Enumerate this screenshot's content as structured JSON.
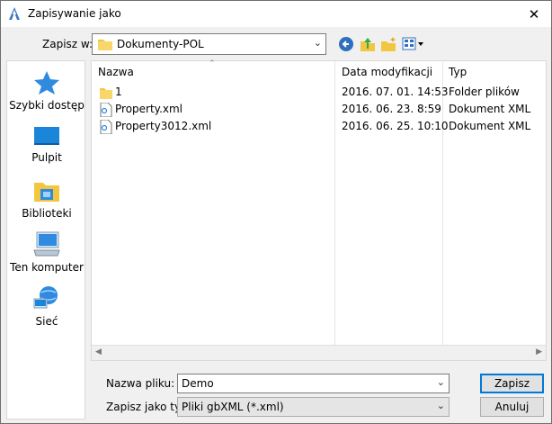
{
  "window": {
    "title": "Zapisywanie jako",
    "close_glyph": "✕"
  },
  "toolbar": {
    "save_in_label": "Zapisz w:",
    "save_in_value": "Dokumenty-POL",
    "icons": [
      "back-icon",
      "up-folder-icon",
      "new-folder-icon",
      "view-menu-icon"
    ]
  },
  "sidebar": {
    "items": [
      {
        "label": "Szybki dostęp",
        "icon": "quick-access-star-icon"
      },
      {
        "label": "Pulpit",
        "icon": "desktop-icon"
      },
      {
        "label": "Biblioteki",
        "icon": "libraries-icon"
      },
      {
        "label": "Ten komputer",
        "icon": "computer-icon"
      },
      {
        "label": "Sieć",
        "icon": "network-icon"
      }
    ]
  },
  "filelist": {
    "columns": {
      "name": "Nazwa",
      "date": "Data modyfikacji",
      "type": "Typ"
    },
    "rows": [
      {
        "name": "1",
        "date": "2016. 07. 01. 14:53",
        "type": "Folder plików",
        "icon": "folder-icon"
      },
      {
        "name": "Property.xml",
        "date": "2016. 06. 23. 8:59",
        "type": "Dokument XML",
        "icon": "xml-file-icon"
      },
      {
        "name": "Property3012.xml",
        "date": "2016. 06. 25. 10:10",
        "type": "Dokument XML",
        "icon": "xml-file-icon"
      }
    ]
  },
  "form": {
    "filename_label": "Nazwa pliku:",
    "filename_value": "Demo",
    "filetype_label": "Zapisz jako typ:",
    "filetype_value": "Pliki gbXML (*.xml)"
  },
  "buttons": {
    "save": "Zapisz",
    "cancel": "Anuluj"
  },
  "colors": {
    "accent": "#0078d7",
    "folder": "#f3c640",
    "window_bg": "#f0f0f0"
  }
}
